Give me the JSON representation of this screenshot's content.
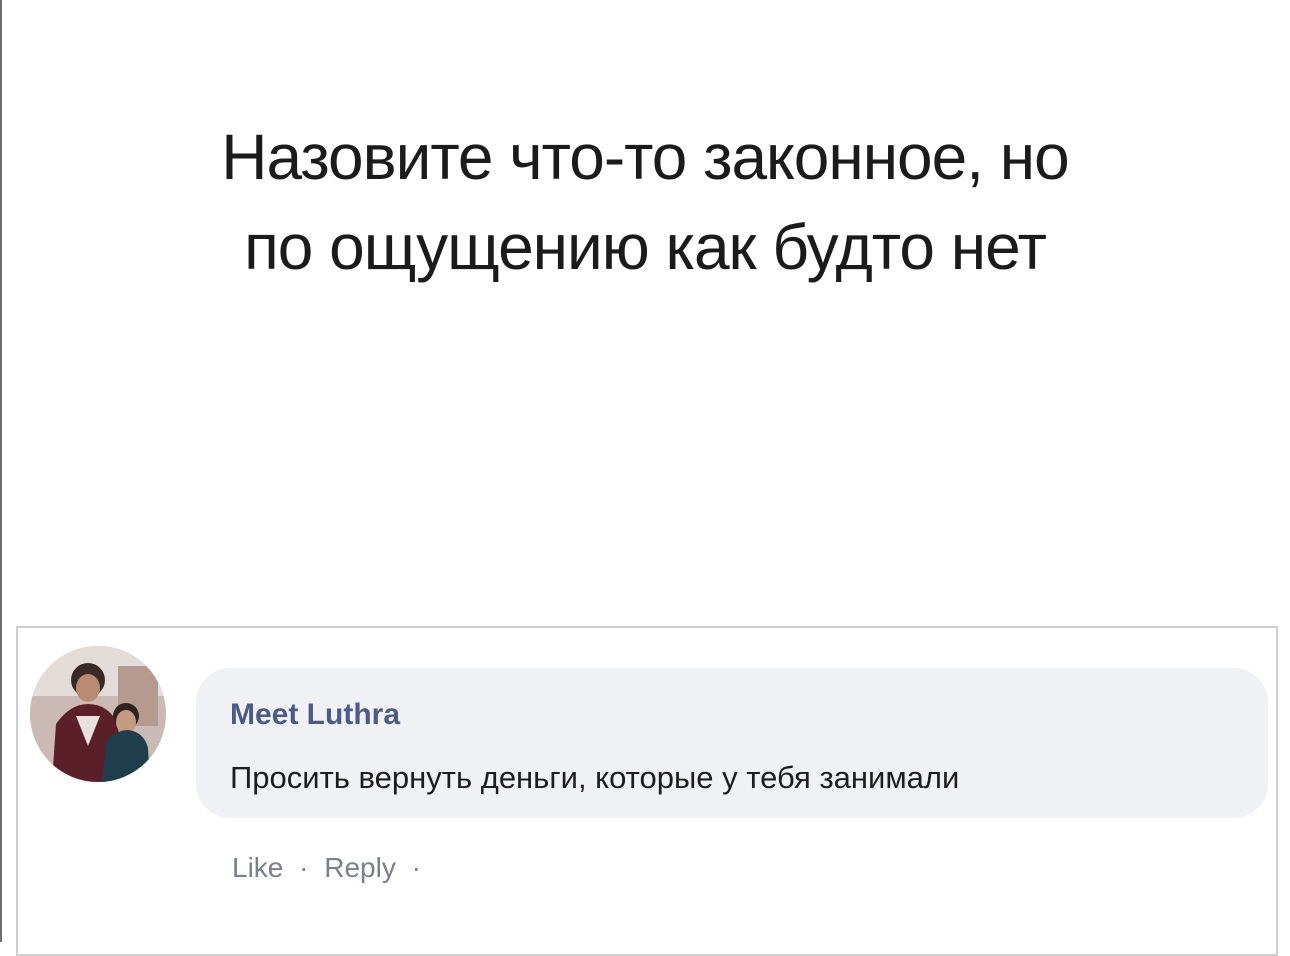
{
  "post": {
    "headline_line1": "Назовите что-то законное, но",
    "headline_line2": "по ощущению как будто нет"
  },
  "comment": {
    "author": "Meet Luthra",
    "text": "Просить вернуть деньги, которые у тебя занимали",
    "actions": {
      "like": "Like",
      "reply": "Reply",
      "separator": "·"
    },
    "avatar_icon": "profile-photo"
  },
  "colors": {
    "author_name": "#4c5a88",
    "bubble_background": "#f0f1f5",
    "action_text": "#7a8090",
    "headline_text": "#1b1b1b"
  }
}
